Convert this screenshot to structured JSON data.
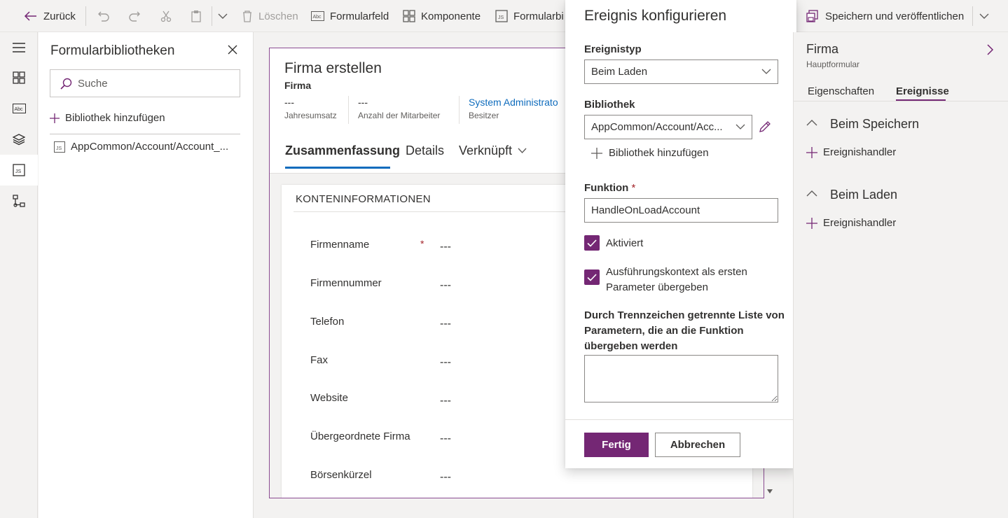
{
  "toolbar": {
    "back": "Zurück",
    "delete": "Löschen",
    "form_field": "Formularfeld",
    "component": "Komponente",
    "form_library": "Formularbi",
    "save_publish": "Speichern und veröffentlichen"
  },
  "library_panel": {
    "title": "Formularbibliotheken",
    "search_placeholder": "Suche",
    "add_library": "Bibliothek hinzufügen",
    "items": [
      {
        "label": "AppCommon/Account/Account_..."
      }
    ]
  },
  "form": {
    "title": "Firma erstellen",
    "entity": "Firma",
    "header_fields": [
      {
        "value": "---",
        "label": "Jahresumsatz"
      },
      {
        "value": "---",
        "label": "Anzahl der Mitarbeiter"
      },
      {
        "value": "System Administrato",
        "label": "Besitzer"
      }
    ],
    "tabs": [
      "Zusammenfassung",
      "Details",
      "Verknüpft"
    ],
    "section_title": "KONTENINFORMATIONEN",
    "fields": [
      {
        "label": "Firmenname",
        "value": "---",
        "required": "*"
      },
      {
        "label": "Firmennummer",
        "value": "---"
      },
      {
        "label": "Telefon",
        "value": "---"
      },
      {
        "label": "Fax",
        "value": "---"
      },
      {
        "label": "Website",
        "value": "---"
      },
      {
        "label": "Übergeordnete Firma",
        "value": "---"
      },
      {
        "label": "Börsenkürzel",
        "value": "---"
      }
    ]
  },
  "modal": {
    "title": "Ereignis konfigurieren",
    "event_type_label": "Ereignistyp",
    "event_type_value": "Beim Laden",
    "library_label": "Bibliothek",
    "library_value": "AppCommon/Account/Acc...",
    "add_library": "Bibliothek hinzufügen",
    "function_label": "Funktion",
    "required_marker": "*",
    "function_value": "HandleOnLoadAccount",
    "enabled_label": "Aktiviert",
    "pass_context_label_1": "Ausführungskontext als ersten",
    "pass_context_label_2": "Parameter übergeben",
    "params_label_1": "Durch Trennzeichen getrennte Liste von",
    "params_label_2": "Parametern, die an die Funktion",
    "params_label_3": "übergeben werden",
    "params_value": "",
    "done": "Fertig",
    "cancel": "Abbrechen"
  },
  "right_panel": {
    "title": "Firma",
    "subtitle": "Hauptformular",
    "tabs": [
      "Eigenschaften",
      "Ereignisse"
    ],
    "active_tab": "Ereignisse",
    "sections": [
      {
        "title": "Beim Speichern",
        "add": "Ereignishandler"
      },
      {
        "title": "Beim Laden",
        "add": "Ereignishandler"
      }
    ]
  },
  "colors": {
    "accent": "#742774",
    "link": "#0f6cbd",
    "required": "#a4262c",
    "frame_border": "#8a4b91"
  }
}
